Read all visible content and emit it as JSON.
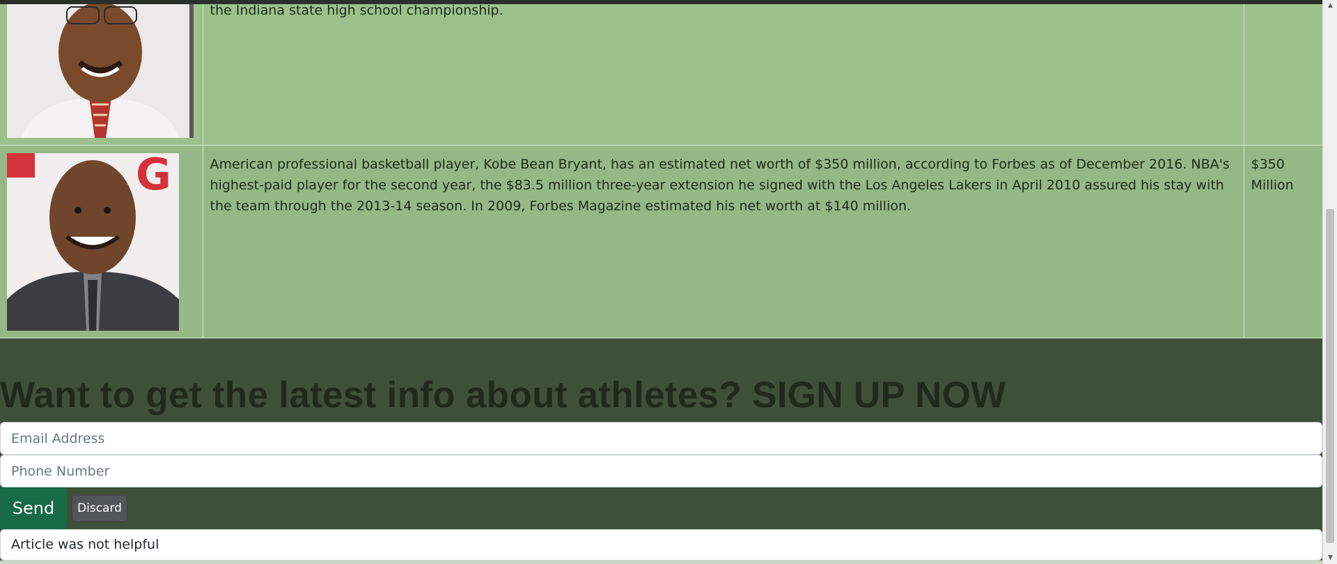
{
  "rows": [
    {
      "description": "the Indiana state high school championship.",
      "net_worth": ""
    },
    {
      "description": "American professional basketball player, Kobe Bean Bryant, has an estimated net worth of $350 million, according to Forbes as of December 2016. NBA's highest-paid player for the second year, the $83.5 million three-year extension he signed with the Los Angeles Lakers in April 2010 assured his stay with the team through the 2013-14 season. In 2009, Forbes Magazine estimated his net worth at $140 million.",
      "net_worth": "$350 Million"
    }
  ],
  "signup": {
    "headline": "Want to get the latest info about athletes? SIGN UP NOW",
    "email_placeholder": "Email Address",
    "phone_placeholder": "Phone Number",
    "send_label": "Send",
    "discard_label": "Discard",
    "feedback_text": "Article was not helpful"
  },
  "colors": {
    "page_background": "#3e5039",
    "row_background": "#9dc18b",
    "send_button": "#176b46",
    "discard_button": "#50555a"
  },
  "icons": {
    "scroll_up": "triangle-up-icon",
    "scroll_down": "triangle-down-icon"
  }
}
